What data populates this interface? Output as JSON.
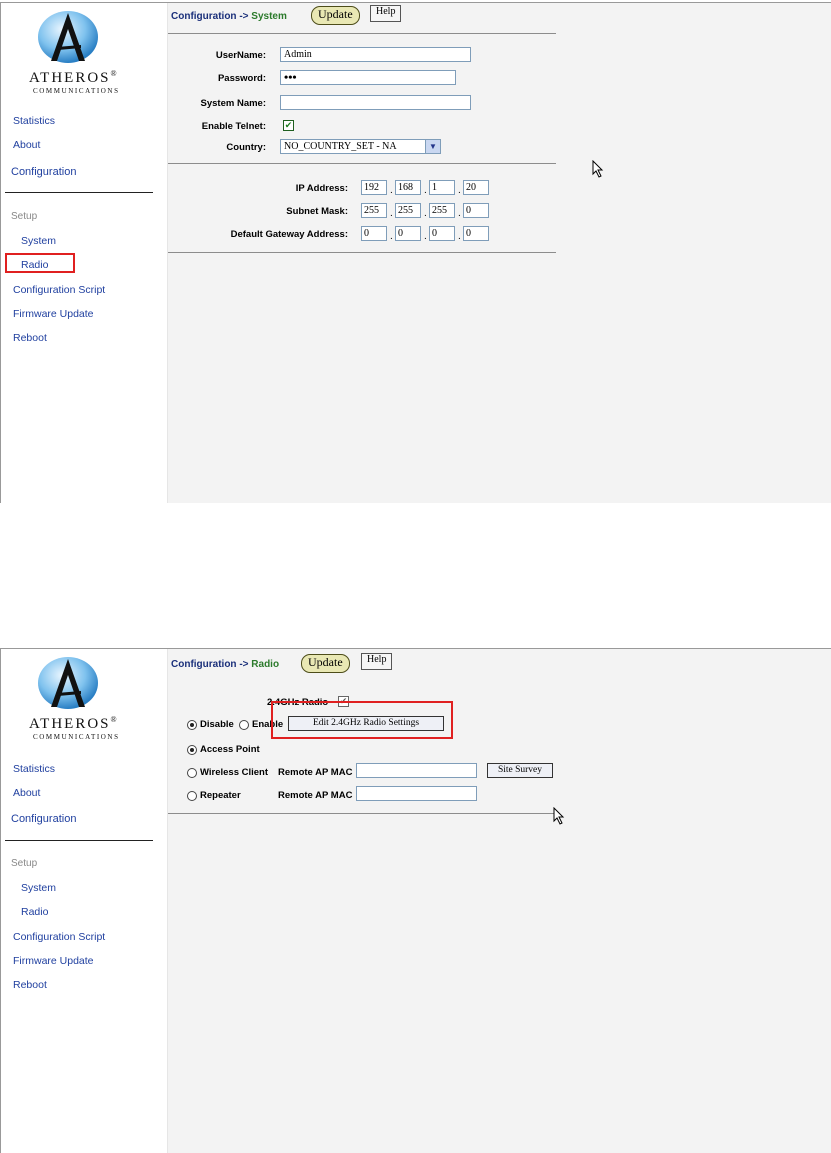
{
  "logo": {
    "brand": "ATHEROS",
    "reg": "®",
    "sub": "COMMUNICATIONS"
  },
  "nav": {
    "statistics": "Statistics",
    "about": "About",
    "configuration": "Configuration",
    "setup": "Setup",
    "system": "System",
    "radio": "Radio",
    "config_script": "Configuration Script",
    "firmware_update": "Firmware Update",
    "reboot": "Reboot"
  },
  "buttons": {
    "update": "Update",
    "help": "Help"
  },
  "system_page": {
    "crumb_prefix": "Configuration ->",
    "crumb_page": "System",
    "username_label": "UserName:",
    "username_value": "Admin",
    "password_label": "Password:",
    "password_value": "•••",
    "system_name_label": "System Name:",
    "system_name_value": "",
    "telnet_label": "Enable Telnet:",
    "country_label": "Country:",
    "country_value": "NO_COUNTRY_SET - NA",
    "ip_label": "IP Address:",
    "ip": [
      "192",
      "168",
      "1",
      "20"
    ],
    "subnet_label": "Subnet Mask:",
    "subnet": [
      "255",
      "255",
      "255",
      "0"
    ],
    "gateway_label": "Default Gateway Address:",
    "gateway": [
      "0",
      "0",
      "0",
      "0"
    ]
  },
  "radio_page": {
    "crumb_prefix": "Configuration ->",
    "crumb_page": "Radio",
    "radio_24_label": "2.4GHz Radio",
    "disable": "Disable",
    "enable": "Enable",
    "edit_button": "Edit 2.4GHz Radio Settings",
    "access_point": "Access Point",
    "wireless_client": "Wireless Client",
    "repeater": "Repeater",
    "remote_ap_mac": "Remote AP MAC",
    "site_survey": "Site Survey"
  },
  "colors": {
    "highlight": "#e02020",
    "link": "#1f3f9f",
    "crumb_page": "#2b7a2b"
  }
}
